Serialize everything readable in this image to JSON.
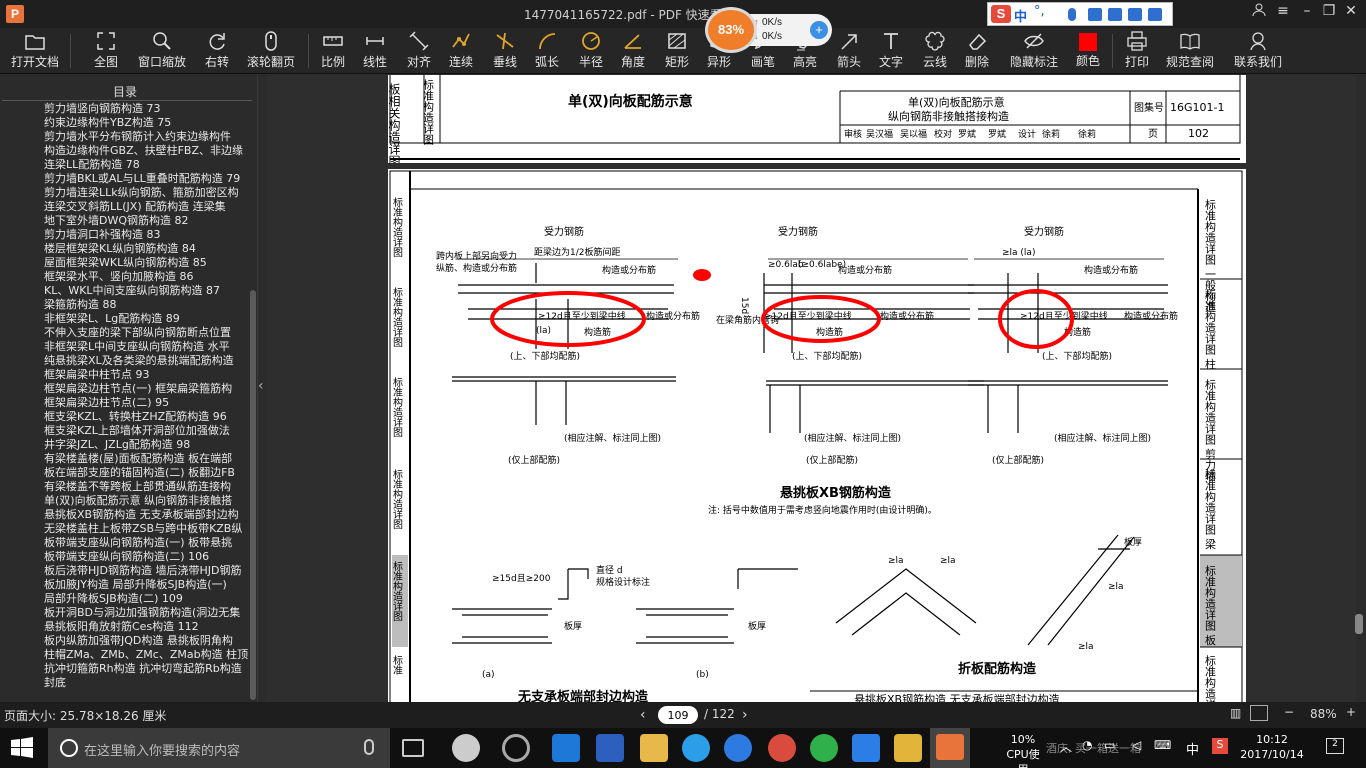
{
  "window": {
    "title": "1477041165722.pdf - PDF 快速看图",
    "app_logo": "P",
    "perf_percent": "83%",
    "net_up": "0K/s",
    "net_down": "0K/s",
    "net_plus": "+",
    "ime": {
      "logo": "S",
      "lang": "中",
      "punct": "°,"
    }
  },
  "toolbar": {
    "items": [
      {
        "label": "打开文档",
        "icon": "folder-icon"
      },
      {
        "label": "全图",
        "icon": "fit-icon"
      },
      {
        "label": "窗口缩放",
        "icon": "zoom-window-icon"
      },
      {
        "label": "右转",
        "icon": "rotate-right-icon"
      },
      {
        "label": "滚轮翻页",
        "icon": "mouse-wheel-icon"
      },
      {
        "label": "比例",
        "icon": "scale-icon"
      },
      {
        "label": "线性",
        "icon": "linear-measure-icon"
      },
      {
        "label": "对齐",
        "icon": "align-measure-icon"
      },
      {
        "label": "连续",
        "icon": "continuous-measure-icon"
      },
      {
        "label": "垂线",
        "icon": "perpendicular-icon"
      },
      {
        "label": "弧长",
        "icon": "arc-length-icon"
      },
      {
        "label": "半径",
        "icon": "radius-icon"
      },
      {
        "label": "角度",
        "icon": "angle-icon"
      },
      {
        "label": "矩形",
        "icon": "rectangle-area-icon"
      },
      {
        "label": "异形",
        "icon": "polygon-area-icon"
      },
      {
        "label": "画笔",
        "icon": "pen-icon"
      },
      {
        "label": "高亮",
        "icon": "highlight-icon"
      },
      {
        "label": "箭头",
        "icon": "arrow-icon"
      },
      {
        "label": "文字",
        "icon": "text-icon"
      },
      {
        "label": "云线",
        "icon": "cloud-line-icon"
      },
      {
        "label": "删除",
        "icon": "eraser-icon"
      },
      {
        "label": "隐藏标注",
        "icon": "hide-annotation-icon"
      },
      {
        "label": "颜色",
        "icon": "color-swatch-icon",
        "color": "#ff0000"
      },
      {
        "label": "打印",
        "icon": "print-icon"
      },
      {
        "label": "规范查阅",
        "icon": "book-icon"
      },
      {
        "label": "联系我们",
        "icon": "contact-icon"
      }
    ]
  },
  "toc": {
    "header": "目录",
    "items": [
      "剪力墙竖向钢筋构造 73",
      "约束边缘构件YBZ构造 75",
      "剪力墙水平分布钢筋计入约束边缘构件",
      "构造边缘构件GBZ、扶壁柱FBZ、非边缘",
      "连梁LL配筋构造 78",
      "剪力墙BKL或AL与LL重叠时配筋构造 79",
      "剪力墙连梁LLk纵向钢筋、箍筋加密区构",
      "连梁交叉斜筋LL(JX) 配筋构造 连梁集",
      "地下室外墙DWQ钢筋构造 82",
      "剪力墙洞口补强构造 83",
      "楼层框架梁KL纵向钢筋构造 84",
      "屋面框架梁WKL纵向钢筋构造 85",
      "框架梁水平、竖向加腋构造 86",
      "KL、WKL中间支座纵向钢筋构造 87",
      "梁箍筋构造 88",
      "非框架梁L、Lg配筋构造 89",
      "不伸入支座的梁下部纵向钢筋断点位置",
      "非框架梁L中间支座纵向钢筋构造 水平",
      "纯悬挑梁XL及各类梁的悬挑端配筋构造",
      "框架扁梁中柱节点 93",
      "框架扁梁边柱节点(一) 框架扁梁箍筋构",
      "框架扁梁边柱节点(二) 95",
      "框支梁KZL、转换柱ZHZ配筋构造 96",
      "框支梁KZL上部墙体开洞部位加强做法",
      "井字梁JZL、JZLg配筋构造 98",
      "有梁楼盖楼(屋)面板配筋构造 板在端部",
      "板在端部支座的锚固构造(二) 板翻边FB",
      "有梁楼盖不等跨板上部贯通纵筋连接构",
      "单(双)向板配筋示意 纵向钢筋非接触搭",
      "悬挑板XB钢筋构造 无支承板端部封边构",
      "无梁楼盖柱上板带ZSB与跨中板带KZB纵",
      "板带端支座纵向钢筋构造(一) 板带悬挑",
      "板带端支座纵向钢筋构造(二) 106",
      "板后浇带HJD钢筋构造 墙后浇带HJD钢筋",
      "板加腋JY构造 局部升降板SJB构造(一)",
      "局部升降板SJB构造(二) 109",
      "板开洞BD与洞边加强钢筋构造(洞边无集",
      "悬挑板阳角放射筋Ces构造 112",
      "板内纵筋加强带JQD构造 悬挑板阴角构",
      "柱帽ZMa、ZMb、ZMc、ZMab构造 柱顶",
      "抗冲切箍筋Rh构造 抗冲切弯起筋Rb构造",
      "封底"
    ]
  },
  "document": {
    "page1": {
      "side_label": "板相关构造详图",
      "side_label2": "标准构造详图",
      "main_title": "单(双)向板配筋示意",
      "titleblock_line1": "单(双)向板配筋示意",
      "titleblock_line2": "纵向钢筋非接触搭接构造",
      "atlas_no_label": "图集号",
      "atlas_no": "16G101-1",
      "page_label": "页",
      "page_no": "102",
      "sign_row": [
        "审核",
        "吴汉福",
        "吴以福",
        "校对",
        "罗斌",
        "罗斌",
        "设计",
        "徐莉",
        "徐莉"
      ]
    },
    "page2": {
      "right_tabs": [
        "标准构造详图 一般构造",
        "标准构造详图 柱",
        "标准构造详图 剪力墙",
        "标准构造详图 梁",
        "标准构造详图 板",
        "标准构造详图 楼板相关"
      ],
      "left_tabs": [
        "标准构造详图",
        "标准构造详图",
        "标准构造详图",
        "标准构造详图",
        "标准构造详图",
        "标准"
      ],
      "labels": {
        "rebar_main": "受力钢筋",
        "span_note1": "跨内板上部另向受力",
        "span_note2": "纵筋、构造或分布筋",
        "dist_note": "距梁边为1/2板筋间距",
        "struct_dist": "构造或分布筋",
        "struct_dist2": "构造或分布筋",
        "anchor_main": "≥12d且至少到梁中线",
        "la_paren": "(la)",
        "struct_rebar": "构造筋",
        "both_rebar": "(上、下部均配筋)",
        "top_only": "(仅上部配筋)",
        "same_above": "(相应注解、标注同上图)",
        "corner_hook": "在梁角筋内弯钩",
        "d06_1": "≥0.6lab",
        "d06_2": "(≥0.6labe)",
        "dim15": "15d",
        "la_top": "≥la (la)",
        "section_title": "悬挑板XB钢筋构造",
        "note": "注: 括号中数值用于需考虑竖向地震作用时(由设计明确)。",
        "diam_d": "直径 d",
        "spec_note": "规格设计标注",
        "ge15d": "≥15d且≥200",
        "slab_thk": "板厚",
        "a_label": "(a)",
        "b_label": "(b)",
        "fold_title": "折板配筋构造",
        "no_support_title": "无支承板端部封边构造",
        "bottom_caption": "悬挑板XB钢筋构造  无支承板端部封边构造",
        "la": "≥la",
        "la2": "≥la",
        "la3": "≥la",
        "la4": "≥la",
        "slab_thk2": "板厚",
        "slab_thk3": "板厚"
      },
      "annotation_color": "#ff0000"
    }
  },
  "status": {
    "page_size": "页面大小: 25.78×18.26 厘米",
    "current_page": "109",
    "total_pages": "/ 122",
    "zoom": "88%",
    "prev": "‹",
    "next": "›",
    "zoom_minus": "−",
    "zoom_plus": "+"
  },
  "taskbar": {
    "search_placeholder": "在这里输入你要搜索的内容",
    "cpu_percent": "10%",
    "cpu_label": "CPU使用",
    "ime": "中",
    "time": "10:12",
    "date": "2017/10/14",
    "notifications": "2",
    "ticker": "酒庆, 买一箱送一箱"
  }
}
